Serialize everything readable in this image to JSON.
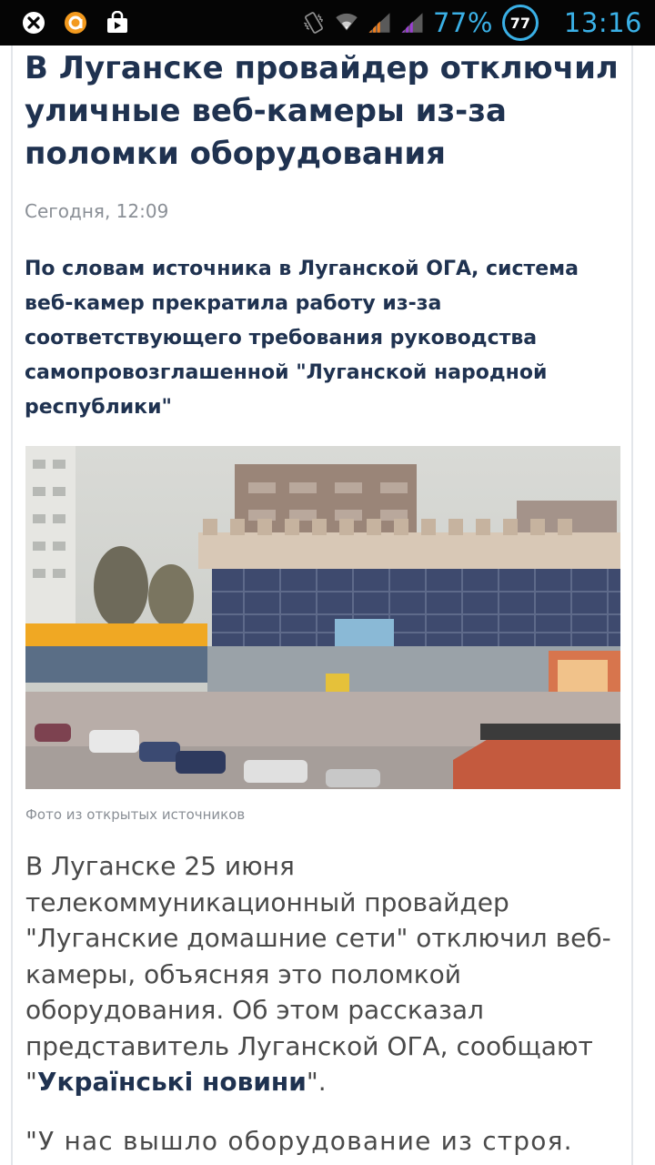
{
  "status_bar": {
    "battery_percent": "77%",
    "badge_value": "77",
    "time": "13:16",
    "accent_color": "#3ab0e6",
    "icons": [
      "close-circle-icon",
      "orange-circle-app-icon",
      "shopping-bag-icon",
      "vibrate-icon",
      "wifi-icon",
      "signal-icon",
      "signal-icon-2",
      "battery-circle-icon"
    ]
  },
  "article": {
    "headline": "В Луганске провайдер отключил уличные веб-камеры из-за поломки оборудования",
    "date": "Сегодня, 12:09",
    "lead": "По словам источника в Луганской ОГА, система веб-камер прекратила работу из-за соответствующего требования руководства самопровозглашенной \"Луганской народной республики\"",
    "photo_caption": "Фото из открытых источников",
    "body_p1_text": "В Луганске 25 июня телекоммуникационный провайдер \"Луганские домашние сети\" отключил веб-камеры, объясняя это поломкой оборудования. Об этом рассказал представитель Луганской ОГА, сообщают \"",
    "body_p1_link": "Українські новини",
    "body_p1_end": "\".",
    "body_p2": "\"У нас вышло оборудование из строя."
  }
}
